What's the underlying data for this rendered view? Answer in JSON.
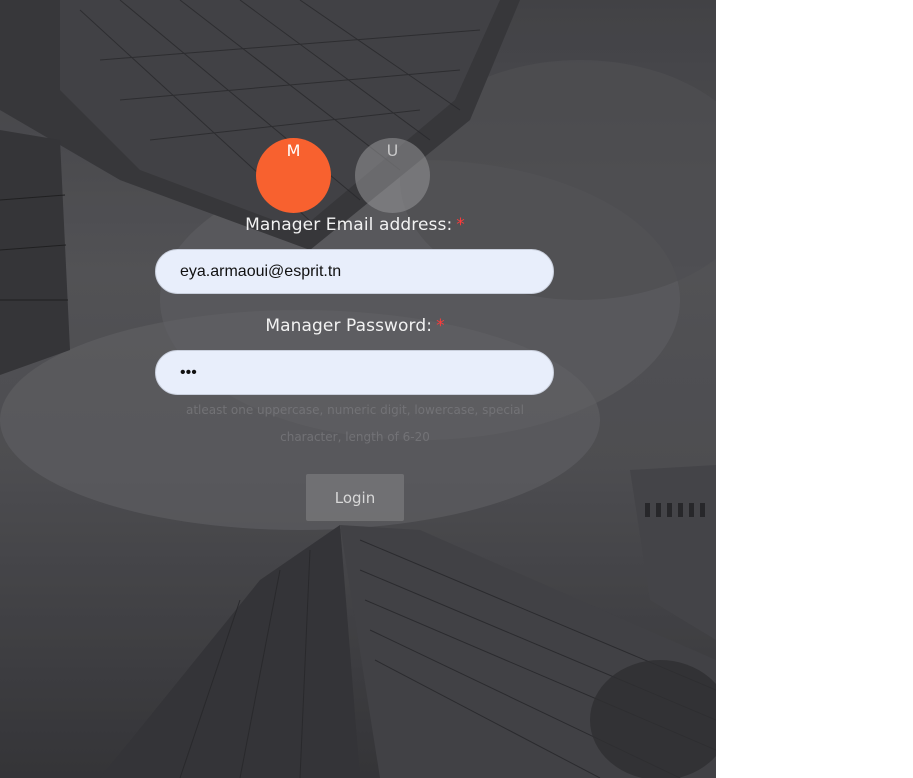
{
  "roles": {
    "manager_label": "M",
    "user_label": "U",
    "active_color": "#f8612f"
  },
  "form": {
    "email_label": "Manager Email address:",
    "email_value": "eya.armaoui@esprit.tn",
    "password_label": "Manager Password:",
    "password_value": "abc",
    "required_mark": "*",
    "hint_line1": "atleast one uppercase, numeric digit, lowercase, special",
    "hint_line2": "character, length of 6-20",
    "login_label": "Login"
  },
  "icons": {
    "background": "skyscrapers-photo"
  }
}
